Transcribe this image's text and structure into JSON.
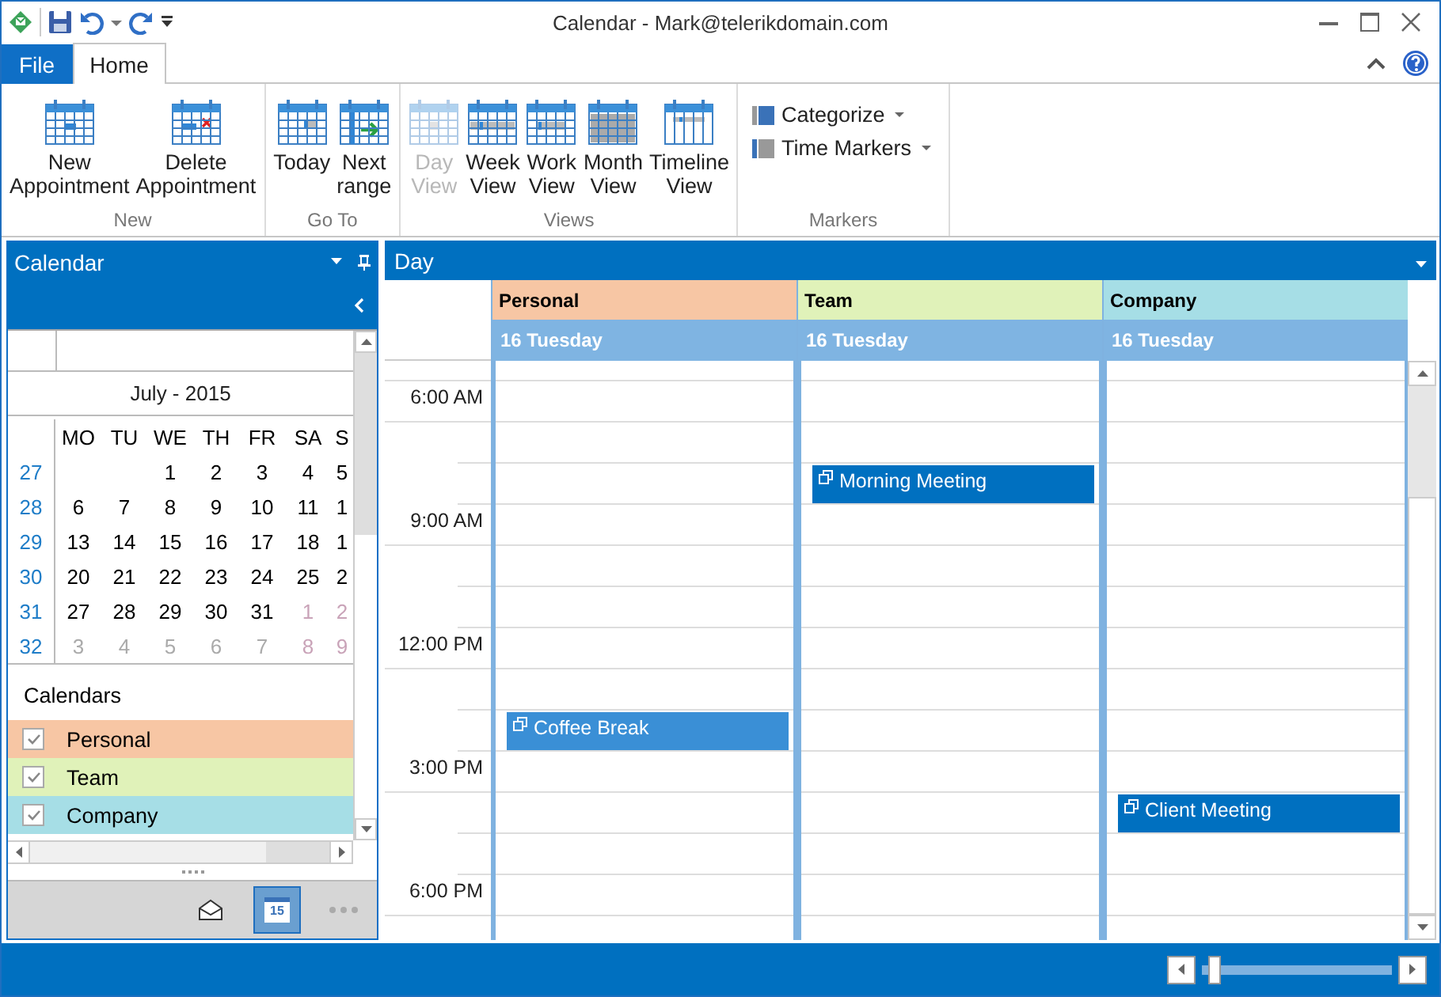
{
  "window": {
    "title": "Calendar - Mark@telerikdomain.com"
  },
  "tabs": [
    {
      "label": "File",
      "kind": "file",
      "selected": false
    },
    {
      "label": "Home",
      "kind": "tab",
      "selected": true
    }
  ],
  "ribbon": {
    "groups": [
      {
        "label": "New",
        "buttons": [
          {
            "label": "New Appointment",
            "kind": "new",
            "disabled": false
          },
          {
            "label": "Delete Appointment",
            "kind": "delete",
            "disabled": false
          }
        ]
      },
      {
        "label": "Go To",
        "buttons": [
          {
            "label": "Today",
            "kind": "today",
            "disabled": false
          },
          {
            "label": "Next range",
            "kind": "next",
            "disabled": false
          }
        ]
      },
      {
        "label": "Views",
        "buttons": [
          {
            "label": "Day View",
            "kind": "day",
            "disabled": true
          },
          {
            "label": "Week View",
            "kind": "week",
            "disabled": false
          },
          {
            "label": "Work View",
            "kind": "work",
            "disabled": false
          },
          {
            "label": "Month View",
            "kind": "month",
            "disabled": false
          },
          {
            "label": "Timeline View",
            "kind": "timeline",
            "disabled": false
          }
        ]
      },
      {
        "label": "Markers",
        "dropdowns": [
          {
            "label": "Categorize",
            "kind": "categorize"
          },
          {
            "label": "Time Markers",
            "kind": "markers"
          }
        ]
      }
    ]
  },
  "sidebar": {
    "title": "Calendar",
    "mini_calendar": {
      "month_title": "July - 2015",
      "weekdays": [
        "MO",
        "TU",
        "WE",
        "TH",
        "FR",
        "SA",
        "S"
      ],
      "weeks": [
        {
          "number": "27",
          "days": [
            {
              "text": "1",
              "other_month": false
            },
            {
              "text": "2",
              "other_month": false
            },
            {
              "text": "3",
              "other_month": false
            },
            {
              "text": "4",
              "other_month": false
            },
            {
              "text": "5",
              "other_month": false
            }
          ]
        },
        {
          "number": "28",
          "days": [
            {
              "text": "6",
              "other_month": false
            },
            {
              "text": "7",
              "other_month": false
            },
            {
              "text": "8",
              "other_month": false
            },
            {
              "text": "9",
              "other_month": false
            },
            {
              "text": "10",
              "other_month": false
            },
            {
              "text": "11",
              "other_month": false
            },
            {
              "text": "1",
              "other_month": false
            }
          ]
        },
        {
          "number": "29",
          "days": [
            {
              "text": "13",
              "other_month": false
            },
            {
              "text": "14",
              "other_month": false
            },
            {
              "text": "15",
              "other_month": false
            },
            {
              "text": "16",
              "other_month": false
            },
            {
              "text": "17",
              "other_month": false
            },
            {
              "text": "18",
              "other_month": false
            },
            {
              "text": "1",
              "other_month": false
            }
          ]
        },
        {
          "number": "30",
          "days": [
            {
              "text": "20",
              "other_month": false
            },
            {
              "text": "21",
              "other_month": false
            },
            {
              "text": "22",
              "other_month": false
            },
            {
              "text": "23",
              "other_month": false
            },
            {
              "text": "24",
              "other_month": false
            },
            {
              "text": "25",
              "other_month": false
            },
            {
              "text": "2",
              "other_month": false
            }
          ]
        },
        {
          "number": "31",
          "days": [
            {
              "text": "27",
              "other_month": false
            },
            {
              "text": "28",
              "other_month": false
            },
            {
              "text": "29",
              "other_month": false
            },
            {
              "text": "30",
              "other_month": false
            },
            {
              "text": "31",
              "other_month": false
            },
            {
              "text": "1",
              "other_month": true
            },
            {
              "text": "2",
              "other_month": true
            }
          ]
        },
        {
          "number": "32",
          "days": [
            {
              "text": "3",
              "other_month": true
            },
            {
              "text": "4",
              "other_month": true
            },
            {
              "text": "5",
              "other_month": true
            },
            {
              "text": "6",
              "other_month": true
            },
            {
              "text": "7",
              "other_month": true
            },
            {
              "text": "8",
              "other_month": true
            },
            {
              "text": "9",
              "other_month": true
            }
          ]
        }
      ]
    },
    "calendars_title": "Calendars",
    "calendars": [
      {
        "name": "Personal",
        "color": "#f7c6a4",
        "checked": true
      },
      {
        "name": "Team",
        "color": "#e0f2b9",
        "checked": true
      },
      {
        "name": "Company",
        "color": "#a6dee6",
        "checked": true
      }
    ],
    "nav": [
      {
        "kind": "mail",
        "selected": false
      },
      {
        "kind": "calendar",
        "label": "15",
        "selected": true
      },
      {
        "kind": "more",
        "selected": false
      }
    ]
  },
  "day_view": {
    "title": "Day",
    "resources": [
      {
        "name": "Personal",
        "color": "#f7c6a4",
        "date": "16 Tuesday"
      },
      {
        "name": "Team",
        "color": "#e0f2b9",
        "date": "16 Tuesday"
      },
      {
        "name": "Company",
        "color": "#a6dee6",
        "date": "16 Tuesday"
      }
    ],
    "rows": [
      {
        "label": "6:00 AM",
        "cells": [
          {
            "kind": "free"
          },
          {
            "kind": "free"
          },
          {
            "kind": "free"
          }
        ]
      },
      {
        "cells": [
          {
            "kind": "free"
          },
          {
            "kind": "free"
          },
          {
            "kind": "free"
          }
        ]
      },
      {
        "cells": [
          {
            "kind": "free"
          },
          {
            "kind": "appointment",
            "title": "Morning Meeting",
            "color": "#0070c0"
          },
          {
            "kind": "free"
          }
        ]
      },
      {
        "label": "9:00 AM",
        "cells": [
          {
            "kind": "free"
          },
          {
            "kind": "free"
          },
          {
            "kind": "free"
          }
        ]
      },
      {
        "cells": [
          {
            "kind": "free"
          },
          {
            "kind": "free"
          },
          {
            "kind": "free"
          }
        ]
      },
      {
        "cells": [
          {
            "kind": "free"
          },
          {
            "kind": "free"
          },
          {
            "kind": "free"
          }
        ]
      },
      {
        "label": "12:00 PM",
        "cells": [
          {
            "kind": "free"
          },
          {
            "kind": "free"
          },
          {
            "kind": "free"
          }
        ]
      },
      {
        "cells": [
          {
            "kind": "free"
          },
          {
            "kind": "free"
          },
          {
            "kind": "free"
          }
        ]
      },
      {
        "cells": [
          {
            "kind": "appointment",
            "title": "Coffee Break",
            "color": "#3a8fd6"
          },
          {
            "kind": "free"
          },
          {
            "kind": "free"
          }
        ]
      },
      {
        "label": "3:00 PM",
        "cells": [
          {
            "kind": "free"
          },
          {
            "kind": "free"
          },
          {
            "kind": "free"
          }
        ]
      },
      {
        "cells": [
          {
            "kind": "free"
          },
          {
            "kind": "free"
          },
          {
            "kind": "appointment",
            "title": "Client Meeting",
            "color": "#0070c0"
          }
        ]
      },
      {
        "cells": [
          {
            "kind": "free"
          },
          {
            "kind": "free"
          },
          {
            "kind": "free"
          }
        ]
      },
      {
        "label": "6:00 PM",
        "cells": [
          {
            "kind": "free"
          },
          {
            "kind": "free"
          },
          {
            "kind": "free"
          }
        ]
      }
    ]
  },
  "status_bar": {
    "zoom": {
      "level": 0.03
    }
  }
}
